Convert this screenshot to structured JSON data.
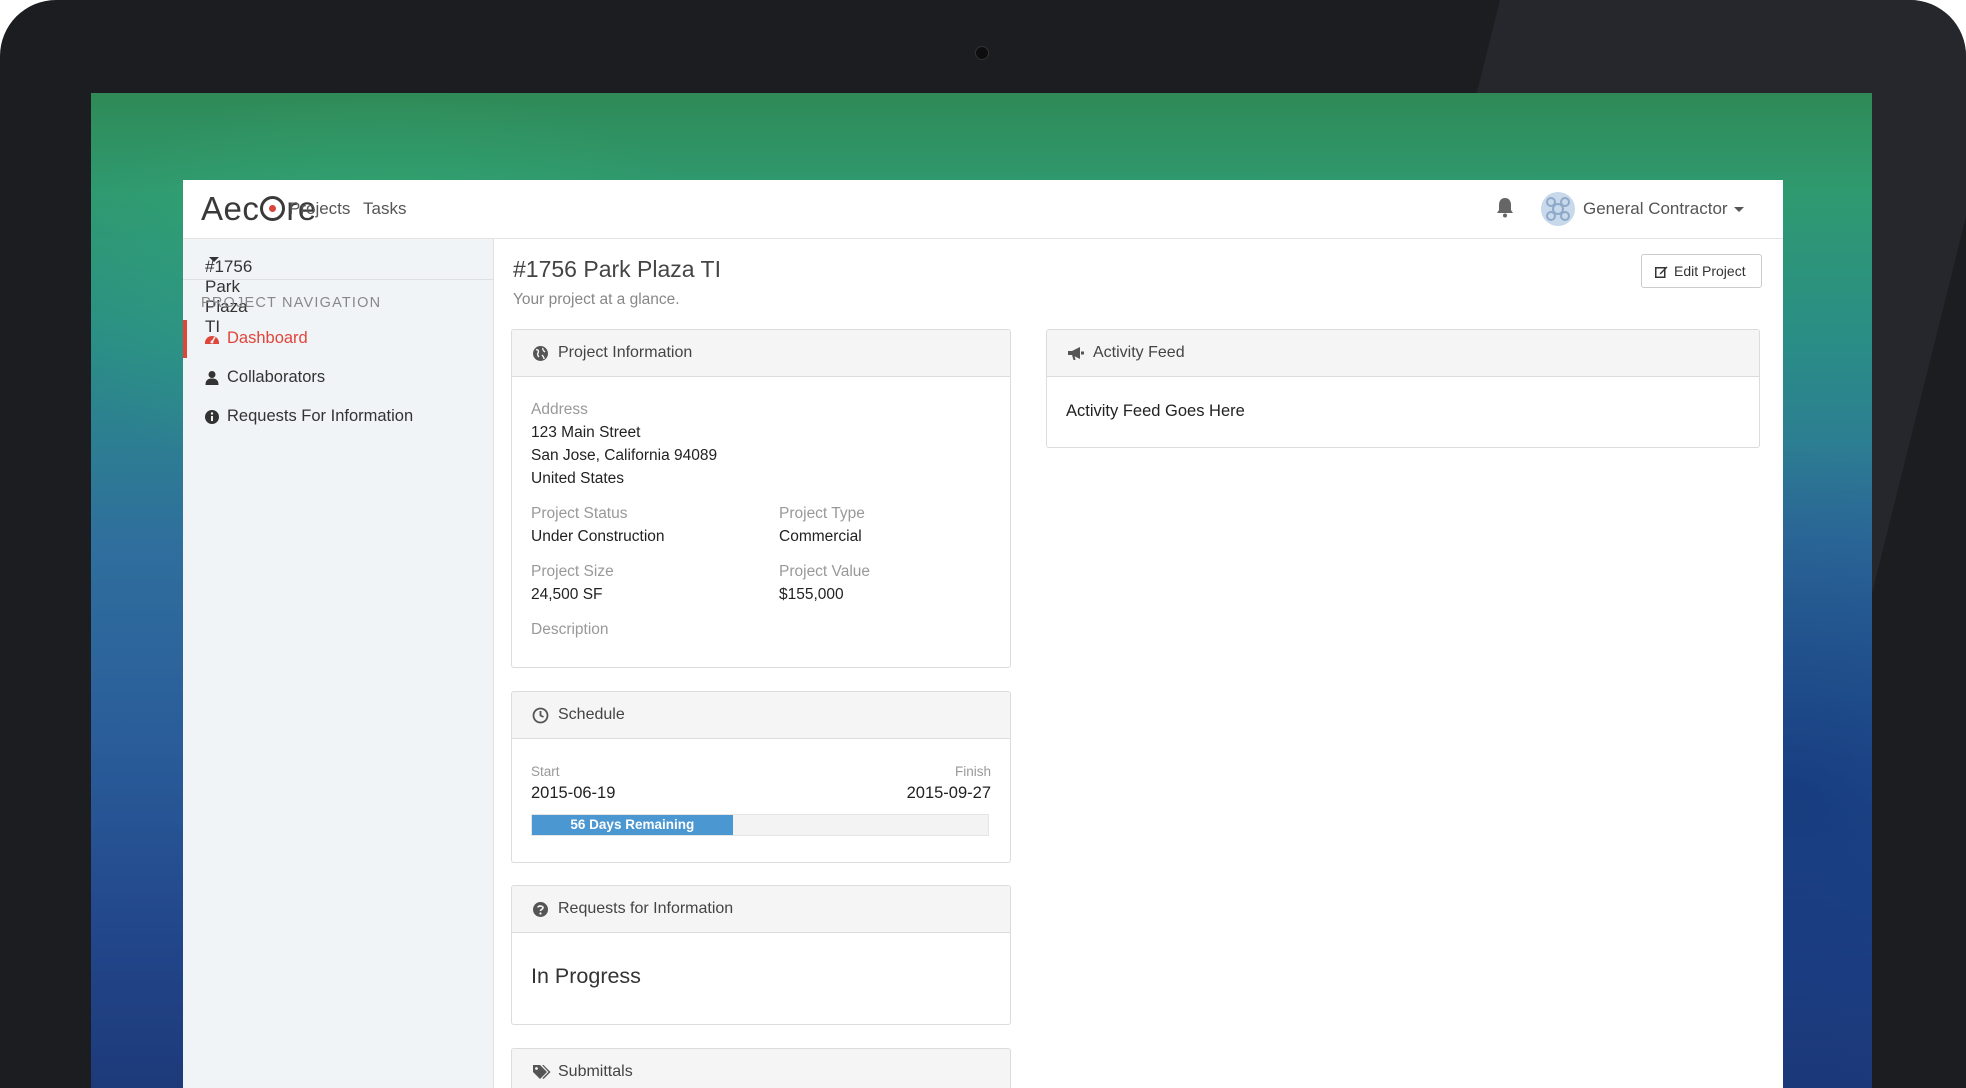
{
  "app": {
    "logo_text": "Aecore",
    "nav": {
      "projects": "Projects",
      "tasks": "Tasks"
    },
    "user": {
      "name": "General Contractor"
    }
  },
  "sidebar": {
    "project_selector": "#1756 Park Plaza TI",
    "heading": "PROJECT NAVIGATION",
    "items": [
      {
        "label": "Dashboard",
        "icon": "dashboard-icon",
        "active": true
      },
      {
        "label": "Collaborators",
        "icon": "user-icon",
        "active": false
      },
      {
        "label": "Requests For Information",
        "icon": "info-circle-icon",
        "active": false
      }
    ]
  },
  "page": {
    "title": "#1756 Park Plaza TI",
    "subtitle": "Your project at a glance.",
    "edit_button": "Edit Project"
  },
  "project_info": {
    "title": "Project Information",
    "address_label": "Address",
    "address_line1": "123 Main Street",
    "address_line2": "San Jose, California 94089",
    "address_line3": "United States",
    "status_label": "Project Status",
    "status_value": "Under Construction",
    "type_label": "Project Type",
    "type_value": "Commercial",
    "size_label": "Project Size",
    "size_value": "24,500 SF",
    "value_label": "Project Value",
    "value_value": "$155,000",
    "description_label": "Description"
  },
  "schedule": {
    "title": "Schedule",
    "start_label": "Start",
    "start_date": "2015-06-19",
    "finish_label": "Finish",
    "finish_date": "2015-09-27",
    "progress_text": "56 Days Remaining",
    "progress_fraction": 0.44
  },
  "rfi": {
    "title": "Requests for Information",
    "status": "In Progress"
  },
  "submittals": {
    "title": "Submittals"
  },
  "activity": {
    "title": "Activity Feed",
    "text": "Activity Feed Goes Here"
  },
  "colors": {
    "accent_red": "#e0453a",
    "progress_blue": "#4a97d2"
  }
}
